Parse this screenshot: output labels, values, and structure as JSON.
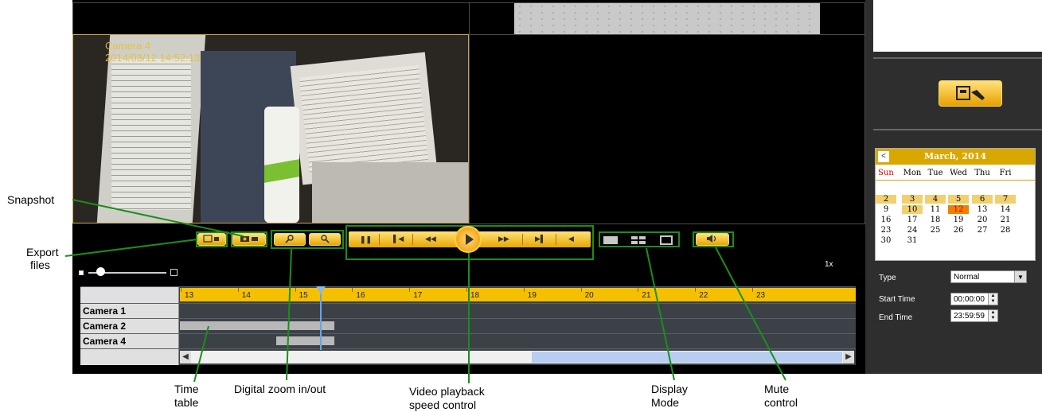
{
  "camera_view": {
    "camera_name": "Camera 4",
    "timestamp": "2014/03/12 14:52:13"
  },
  "playback": {
    "speed": "1x"
  },
  "timeline": {
    "ticks": [
      "13",
      "14",
      "15",
      "16",
      "17",
      "18",
      "19",
      "20",
      "21",
      "22",
      "23"
    ],
    "cameras": [
      "Camera 1",
      "Camera 2",
      "Camera 4"
    ]
  },
  "calendar": {
    "month_label": "March, 2014",
    "weekdays": [
      "Sun",
      "Mon",
      "Tue",
      "Wed",
      "Thu",
      "Fri"
    ],
    "weeks": [
      [
        "2",
        "3",
        "4",
        "5",
        "6",
        "7"
      ],
      [
        "9",
        "10",
        "11",
        "12",
        "13",
        "14"
      ],
      [
        "16",
        "17",
        "18",
        "19",
        "20",
        "21"
      ],
      [
        "23",
        "24",
        "25",
        "26",
        "27",
        "28"
      ],
      [
        "30",
        "31",
        "",
        "",
        "",
        ""
      ]
    ],
    "selected_day": "12",
    "highlight_color": "#f2d070",
    "selected_color": "#f08000"
  },
  "search": {
    "type_label": "Type",
    "type_value": "Normal",
    "start_label": "Start Time",
    "start_value": "00:00:00",
    "end_label": "End Time",
    "end_value": "23:59:59"
  },
  "annotations": {
    "snapshot": "Snapshot",
    "export_files": [
      "Export",
      "files"
    ],
    "time_table": [
      "Time",
      "table"
    ],
    "digital_zoom": "Digital zoom in/out",
    "speed_control": [
      "Video playback",
      "speed control"
    ],
    "display_mode": [
      "Display",
      "Mode"
    ],
    "mute_control": [
      "Mute",
      "control"
    ]
  },
  "colors": {
    "accent_yellow": "#f5c000",
    "annotation_green": "#1a8f1a"
  }
}
